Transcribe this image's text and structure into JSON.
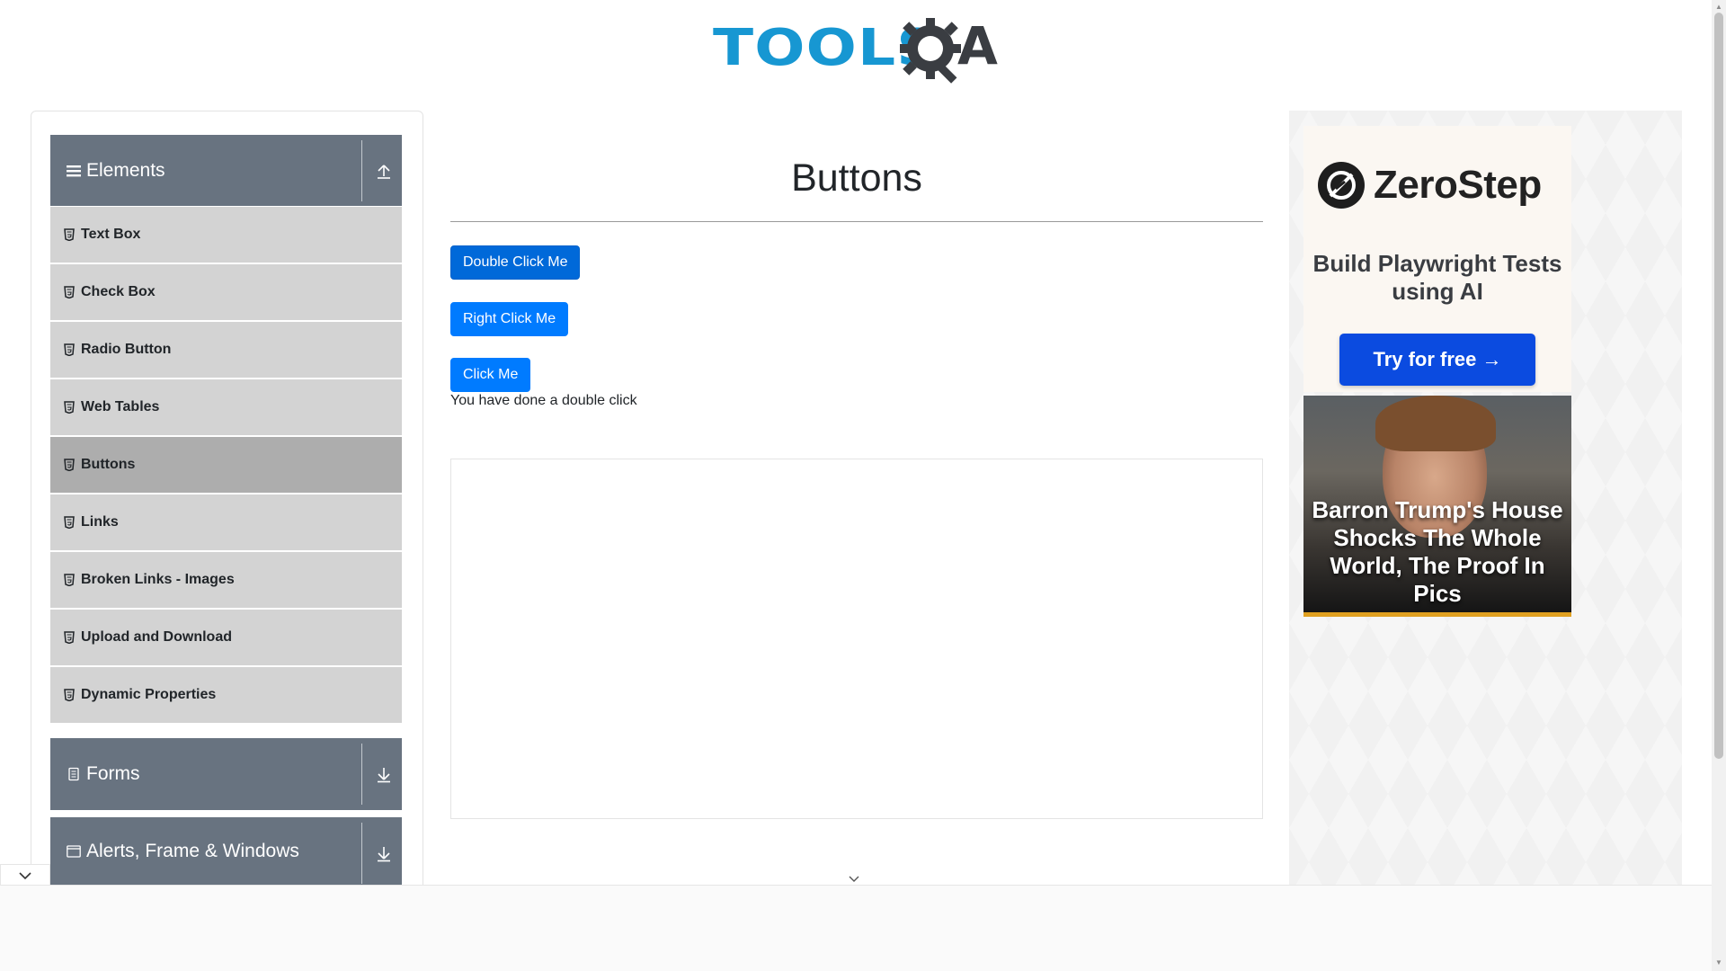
{
  "brand": {
    "logo_text_main": "TOOLS",
    "logo_text_end": "A",
    "logo_colors": {
      "tools": "#1797d2",
      "gear": "#3a3d42"
    }
  },
  "sidebar": {
    "groups": {
      "elements": {
        "label": "Elements",
        "icon": "hamburger-icon",
        "toggle_icon": "upload-icon"
      },
      "forms": {
        "label": "Forms",
        "icon": "document-icon",
        "toggle_icon": "download-icon"
      },
      "alerts": {
        "label": "Alerts, Frame & Windows",
        "icon": "window-icon",
        "toggle_icon": "download-icon"
      }
    },
    "items": [
      {
        "label": "Text Box"
      },
      {
        "label": "Check Box"
      },
      {
        "label": "Radio Button"
      },
      {
        "label": "Web Tables"
      },
      {
        "label": "Buttons",
        "active": true
      },
      {
        "label": "Links"
      },
      {
        "label": "Broken Links - Images"
      },
      {
        "label": "Upload and Download"
      },
      {
        "label": "Dynamic Properties"
      }
    ]
  },
  "main": {
    "title": "Buttons",
    "buttons": {
      "double_click": "Double Click Me",
      "right_click": "Right Click Me",
      "click": "Click Me"
    },
    "result_message": "You have done a double click"
  },
  "right_ad": {
    "brand": "ZeroStep",
    "tagline": "Build Playwright Tests using AI",
    "cta": "Try for free →",
    "news_headline": "Barron Trump's House Shocks The Whole World, The Proof In Pics"
  },
  "colors": {
    "primary_button": "#007bff",
    "sidebar_header": "#687380",
    "sidebar_item": "#d3d3d3",
    "sidebar_item_active": "#adadad"
  }
}
